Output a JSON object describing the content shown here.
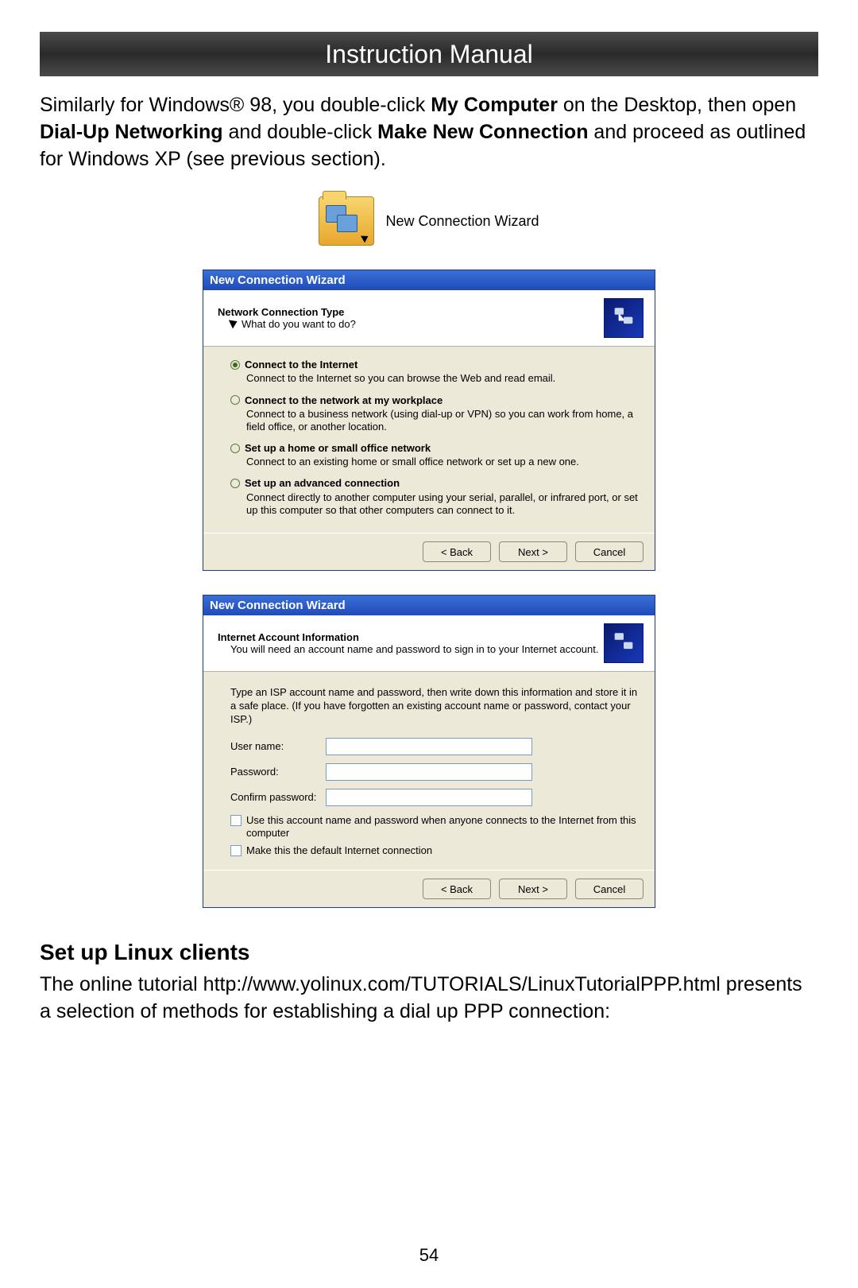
{
  "header": {
    "title": "Instruction Manual"
  },
  "para1": {
    "pre": "Similarly for Windows® 98, you double-click ",
    "b1": "My Computer",
    "mid1": " on the Desktop, then open ",
    "b2": "Dial-Up Networking",
    "mid2": " and double-click ",
    "b3": "Make New Connection",
    "post": " and proceed as outlined for Windows XP (see previous section)."
  },
  "icon_label": "New Connection Wizard",
  "wizard1": {
    "title": "New Connection Wizard",
    "head_line": "Network Connection Type",
    "head_sub": "What do you want to do?",
    "options": [
      {
        "label": "Connect to the Internet",
        "desc": "Connect to the Internet so you can browse the Web and read email.",
        "selected": true
      },
      {
        "label": "Connect to the network at my workplace",
        "desc": "Connect to a business network (using dial-up or VPN) so you can work from home, a field office, or another location.",
        "selected": false
      },
      {
        "label": "Set up a home or small office network",
        "desc": "Connect to an existing home or small office network or set up a new one.",
        "selected": false
      },
      {
        "label": "Set up an advanced connection",
        "desc": "Connect directly to another computer using your serial, parallel, or infrared port, or set up this computer so that other computers can connect to it.",
        "selected": false
      }
    ],
    "back": "< Back",
    "next": "Next >",
    "cancel": "Cancel"
  },
  "wizard2": {
    "title": "New Connection Wizard",
    "head_line": "Internet Account Information",
    "head_sub": "You will need an account name and password to sign in to your Internet account.",
    "instr": "Type an ISP account name and password, then write down this information and store it in a safe place. (If you have forgotten an existing account name or password, contact your ISP.)",
    "fields": {
      "user": "User name:",
      "pass": "Password:",
      "confirm": "Confirm password:"
    },
    "check1": "Use this account  name and password when anyone connects to the Internet from this computer",
    "check2": "Make this the default Internet connection",
    "back": "< Back",
    "next": "Next >",
    "cancel": "Cancel"
  },
  "section_head": "Set up Linux clients",
  "para2": "The online tutorial http://www.yolinux.com/TUTORIALS/LinuxTutorialPPP.html presents a selection of methods for establishing a dial up PPP connection:",
  "page_num": "54"
}
